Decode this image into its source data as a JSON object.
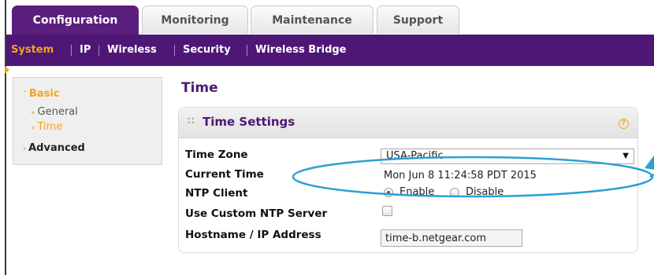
{
  "tabs": [
    {
      "label": "Configuration",
      "active": true
    },
    {
      "label": "Monitoring",
      "active": false
    },
    {
      "label": "Maintenance",
      "active": false
    },
    {
      "label": "Support",
      "active": false
    }
  ],
  "subnav": [
    {
      "label": "System",
      "active": true
    },
    {
      "label": "IP",
      "active": false
    },
    {
      "label": "Wireless",
      "active": false
    },
    {
      "label": "Security",
      "active": false
    },
    {
      "label": "Wireless Bridge",
      "active": false
    }
  ],
  "sidebar": {
    "basic": "Basic",
    "general": "General",
    "time": "Time",
    "advanced": "Advanced"
  },
  "page_title": "Time",
  "panel": {
    "title": "Time Settings",
    "help_icon_text": "?",
    "fields": {
      "time_zone": {
        "label": "Time Zone",
        "value": "USA-Pacific"
      },
      "current_time": {
        "label": "Current Time",
        "value": "Mon Jun 8 11:24:58 PDT 2015"
      },
      "ntp_client": {
        "label": "NTP Client",
        "options": [
          "Enable",
          "Disable"
        ],
        "selected": "Enable"
      },
      "custom_ntp": {
        "label": "Use Custom NTP Server",
        "checked": false
      },
      "hostname": {
        "label": "Hostname / IP Address",
        "value": "time-b.netgear.com"
      }
    }
  },
  "colors": {
    "brand_purple": "#4e1775",
    "active_tab": "#5b1f7d",
    "accent_orange": "#f7a21b",
    "annotation_blue": "#2aa0d6"
  }
}
